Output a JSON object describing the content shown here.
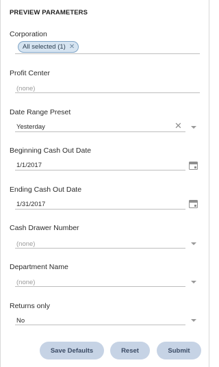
{
  "panel": {
    "title": "PREVIEW PARAMETERS"
  },
  "fields": {
    "corporation": {
      "label": "Corporation",
      "chip": "All selected (1)"
    },
    "profit_center": {
      "label": "Profit Center",
      "value": "(none)"
    },
    "date_range_preset": {
      "label": "Date Range Preset",
      "value": "Yesterday"
    },
    "beginning_date": {
      "label": "Beginning Cash Out Date",
      "value": "1/1/2017"
    },
    "ending_date": {
      "label": "Ending Cash Out Date",
      "value": "1/31/2017"
    },
    "cash_drawer": {
      "label": "Cash Drawer Number",
      "value": "(none)"
    },
    "department": {
      "label": "Department Name",
      "value": "(none)"
    },
    "returns_only": {
      "label": "Returns only",
      "value": "No"
    }
  },
  "buttons": {
    "save_defaults": "Save Defaults",
    "reset": "Reset",
    "submit": "Submit"
  },
  "icons": {
    "chip_remove": "close-icon",
    "clear": "close-icon",
    "dropdown": "chevron-down-icon",
    "date_picker": "calendar-icon"
  },
  "colors": {
    "chip_background": "#d6e4f1",
    "button_background": "#c6d3e5"
  }
}
